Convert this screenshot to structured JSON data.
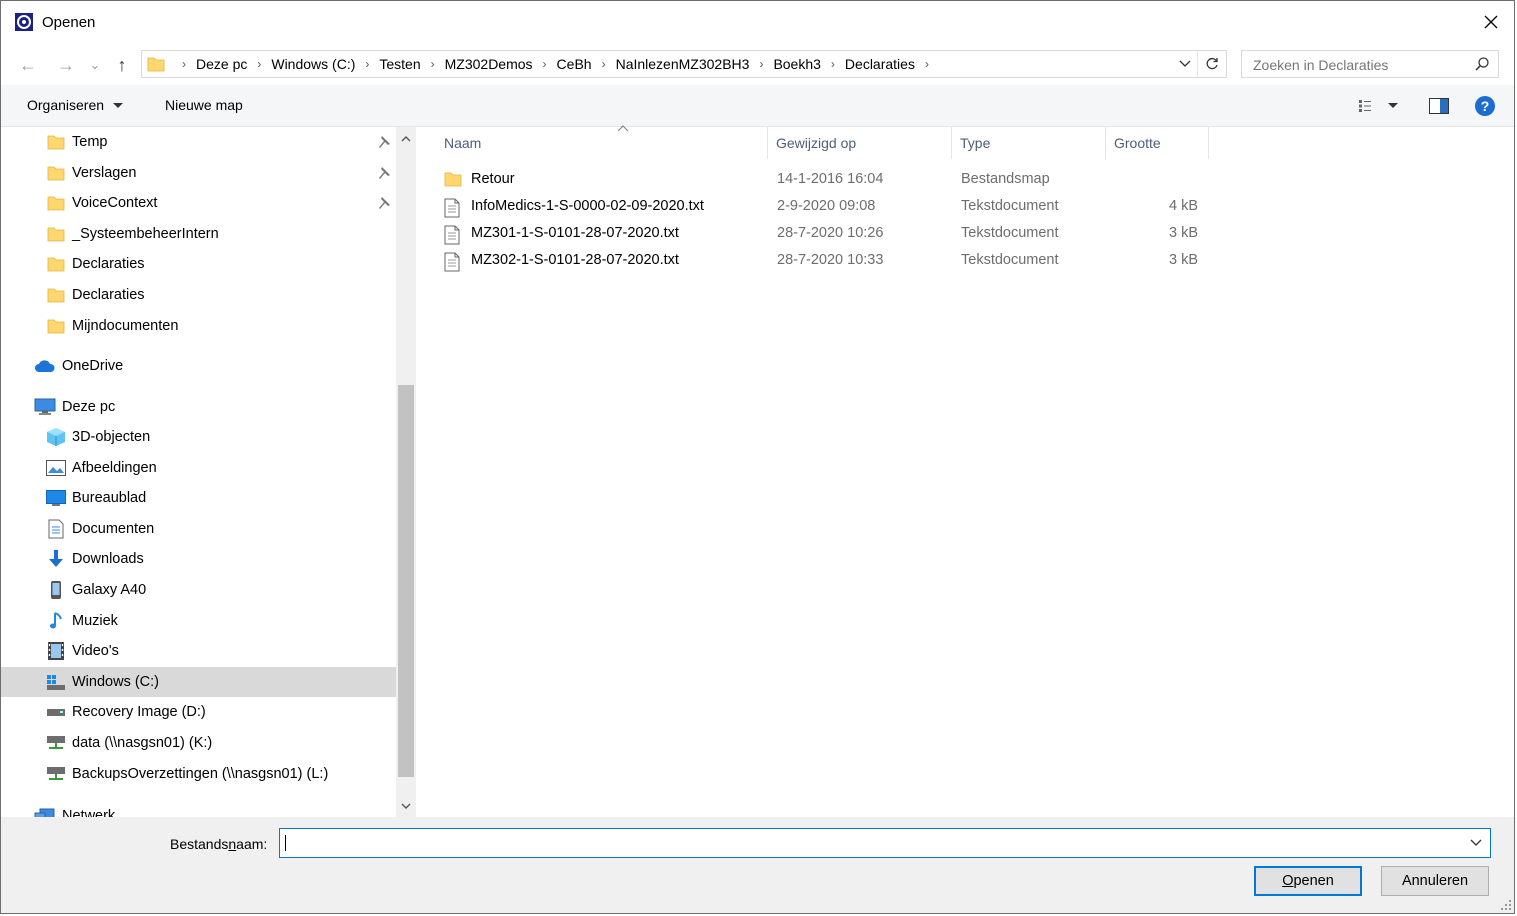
{
  "window": {
    "title": "Openen",
    "close_glyph": "✕"
  },
  "navigation": {
    "back_glyph": "←",
    "forward_glyph": "→",
    "recent_glyph": "⌄",
    "up_glyph": "↑",
    "breadcrumbs": [
      "Deze pc",
      "Windows (C:)",
      "Testen",
      "MZ302Demos",
      "CeBh",
      "NaInlezenMZ302BH3",
      "Boekh3",
      "Declaraties"
    ],
    "search_placeholder": "Zoeken in Declaraties"
  },
  "toolbar": {
    "organize_label": "Organiseren",
    "new_folder_label": "Nieuwe map"
  },
  "sidebar": {
    "quick_access": [
      {
        "label": "Temp",
        "pinned": true
      },
      {
        "label": "Verslagen",
        "pinned": true
      },
      {
        "label": "VoiceContext",
        "pinned": true
      },
      {
        "label": "_SysteembeheerIntern",
        "pinned": false
      },
      {
        "label": "Declaraties",
        "pinned": false
      },
      {
        "label": "Declaraties",
        "pinned": false
      },
      {
        "label": "Mijndocumenten",
        "pinned": false
      }
    ],
    "onedrive_label": "OneDrive",
    "this_pc_label": "Deze pc",
    "this_pc_items": [
      {
        "label": "3D-objecten",
        "icon": "cube-3d-icon"
      },
      {
        "label": "Afbeeldingen",
        "icon": "pictures-icon"
      },
      {
        "label": "Bureaublad",
        "icon": "desktop-icon"
      },
      {
        "label": "Documenten",
        "icon": "documents-icon"
      },
      {
        "label": "Downloads",
        "icon": "downloads-icon"
      },
      {
        "label": "Galaxy A40",
        "icon": "phone-icon"
      },
      {
        "label": "Muziek",
        "icon": "music-icon"
      },
      {
        "label": "Video's",
        "icon": "videos-icon"
      },
      {
        "label": "Windows (C:)",
        "icon": "windows-drive-icon"
      },
      {
        "label": "Recovery Image (D:)",
        "icon": "drive-icon"
      },
      {
        "label": "data (\\\\nasgsn01) (K:)",
        "icon": "network-drive-icon"
      },
      {
        "label": "BackupsOverzettingen (\\\\nasgsn01) (L:)",
        "icon": "network-drive-icon"
      }
    ],
    "network_label": "Netwerk",
    "selected": "Windows (C:)"
  },
  "file_list": {
    "columns": [
      "Naam",
      "Gewijzigd op",
      "Type",
      "Grootte"
    ],
    "sorted_by": "Naam",
    "rows": [
      {
        "name": "Retour",
        "modified": "14-1-2016 16:04",
        "type": "Bestandsmap",
        "size": "",
        "kind": "folder"
      },
      {
        "name": "InfoMedics-1-S-0000-02-09-2020.txt",
        "modified": "2-9-2020 09:08",
        "type": "Tekstdocument",
        "size": "4 kB",
        "kind": "text"
      },
      {
        "name": "MZ301-1-S-0101-28-07-2020.txt",
        "modified": "28-7-2020 10:26",
        "type": "Tekstdocument",
        "size": "3 kB",
        "kind": "text"
      },
      {
        "name": "MZ302-1-S-0101-28-07-2020.txt",
        "modified": "28-7-2020 10:33",
        "type": "Tekstdocument",
        "size": "3 kB",
        "kind": "text"
      }
    ]
  },
  "footer": {
    "filename_label_before": "Bestands",
    "filename_label_underlined": "n",
    "filename_label_after": "aam:",
    "filename_value": "",
    "open_label_underlined": "O",
    "open_label_rest": "penen",
    "cancel_label": "Annuleren"
  },
  "colors": {
    "accent": "#0078d7",
    "folder": "#ffd76e",
    "selection": "#d9d9d9",
    "header_text": "#4c607a"
  }
}
